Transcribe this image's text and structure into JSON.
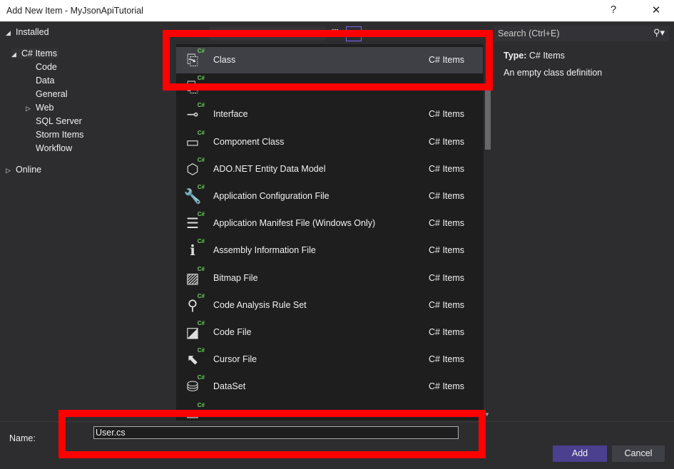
{
  "window": {
    "title": "Add New Item - MyJsonApiTutorial",
    "help": "?",
    "close": "✕"
  },
  "tree": {
    "installed": "Installed",
    "csharp": "C# Items",
    "children": [
      "Code",
      "Data",
      "General",
      "Web",
      "SQL Server",
      "Storm Items",
      "Workflow"
    ],
    "online": "Online"
  },
  "list": {
    "items": [
      {
        "name": "Class",
        "category": "C# Items",
        "icon": "class-icon",
        "glyph": "⎘",
        "selected": true
      },
      {
        "name": "",
        "category": "",
        "icon": "class-icon",
        "glyph": "⎘"
      },
      {
        "name": "Interface",
        "category": "C# Items",
        "icon": "interface-icon",
        "glyph": "⊸"
      },
      {
        "name": "Component Class",
        "category": "C# Items",
        "icon": "component-class-icon",
        "glyph": "▭"
      },
      {
        "name": "ADO.NET Entity Data Model",
        "category": "C# Items",
        "icon": "entity-model-icon",
        "glyph": "⬡"
      },
      {
        "name": "Application Configuration File",
        "category": "C# Items",
        "icon": "config-file-icon",
        "glyph": "🔧"
      },
      {
        "name": "Application Manifest File (Windows Only)",
        "category": "C# Items",
        "icon": "manifest-file-icon",
        "glyph": "☰"
      },
      {
        "name": "Assembly Information File",
        "category": "C# Items",
        "icon": "assembly-info-icon",
        "glyph": "ℹ"
      },
      {
        "name": "Bitmap File",
        "category": "C# Items",
        "icon": "bitmap-icon",
        "glyph": "▨"
      },
      {
        "name": "Code Analysis Rule Set",
        "category": "C# Items",
        "icon": "rule-set-icon",
        "glyph": "⚲"
      },
      {
        "name": "Code File",
        "category": "C# Items",
        "icon": "code-file-icon",
        "glyph": "◪"
      },
      {
        "name": "Cursor File",
        "category": "C# Items",
        "icon": "cursor-icon",
        "glyph": "⬉"
      },
      {
        "name": "DataSet",
        "category": "C# Items",
        "icon": "dataset-icon",
        "glyph": "⛁"
      },
      {
        "name": "",
        "category": "",
        "icon": "debugger-visualizer-icon",
        "glyph": "▭"
      }
    ]
  },
  "details": {
    "search_placeholder": "Search (Ctrl+E)",
    "type_label": "Type:",
    "type_value": "C# Items",
    "description": "An empty class definition"
  },
  "footer": {
    "name_label": "Name:",
    "name_value": "User.cs",
    "add": "Add",
    "cancel": "Cancel"
  },
  "colors": {
    "accent": "#4b3f8f",
    "highlight": "#ff0000",
    "selected_row": "#3f3f46"
  }
}
